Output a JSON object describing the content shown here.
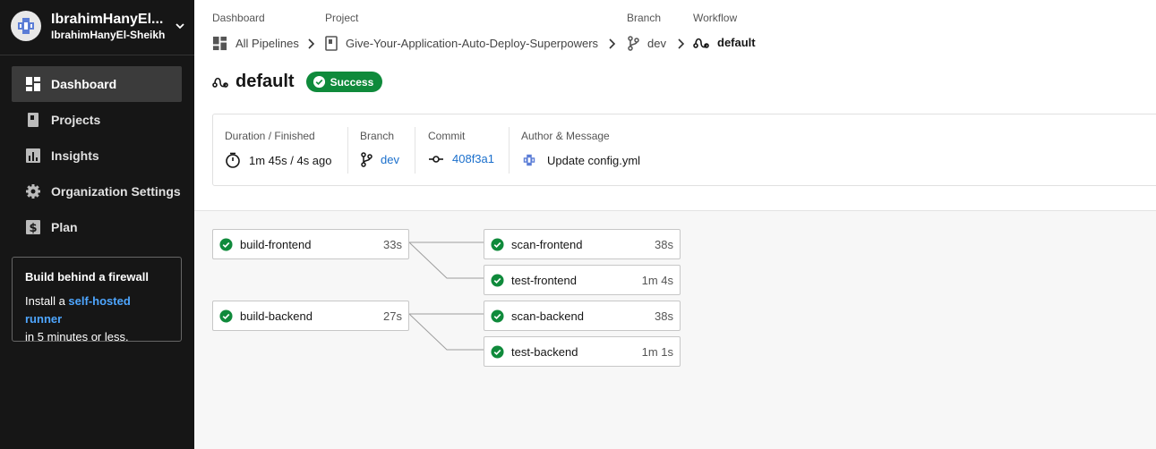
{
  "org": {
    "name": "IbrahimHanyEl...",
    "subtitle": "IbrahimHanyEl-Sheikh"
  },
  "nav": [
    {
      "label": "Dashboard",
      "icon": "dashboard-icon",
      "active": true
    },
    {
      "label": "Projects",
      "icon": "projects-icon",
      "active": false
    },
    {
      "label": "Insights",
      "icon": "insights-icon",
      "active": false
    },
    {
      "label": "Organization Settings",
      "icon": "gear-icon",
      "active": false
    },
    {
      "label": "Plan",
      "icon": "dollar-icon",
      "active": false
    }
  ],
  "promo": {
    "title": "Build behind a firewall",
    "text_before": "Install a ",
    "link": "self-hosted runner",
    "text_after": "in 5 minutes or less."
  },
  "breadcrumbs": [
    {
      "label": "Dashboard",
      "value": "All Pipelines",
      "icon": "pipelines-icon"
    },
    {
      "label": "Project",
      "value": "Give-Your-Application-Auto-Deploy-Superpowers",
      "icon": "project-icon"
    },
    {
      "label": "Branch",
      "value": "dev",
      "icon": "branch-icon"
    },
    {
      "label": "Workflow",
      "value": "default",
      "icon": "workflow-icon"
    }
  ],
  "workflow": {
    "title": "default",
    "status": "Success"
  },
  "info": {
    "duration_label": "Duration / Finished",
    "duration_value": "1m 45s / 4s ago",
    "branch_label": "Branch",
    "branch_value": "dev",
    "commit_label": "Commit",
    "commit_value": "408f3a1",
    "author_label": "Author & Message",
    "author_message": "Update config.yml"
  },
  "jobs": [
    {
      "name": "build-frontend",
      "duration": "33s",
      "status": "success"
    },
    {
      "name": "scan-frontend",
      "duration": "38s",
      "status": "success"
    },
    {
      "name": "test-frontend",
      "duration": "1m 4s",
      "status": "success"
    },
    {
      "name": "build-backend",
      "duration": "27s",
      "status": "success"
    },
    {
      "name": "scan-backend",
      "duration": "38s",
      "status": "success"
    },
    {
      "name": "test-backend",
      "duration": "1m 1s",
      "status": "success"
    }
  ],
  "colors": {
    "sidebar_bg": "#161616",
    "success_green": "#0f8a3b",
    "link_blue": "#1a6fcc",
    "promo_link": "#4ea6ff"
  }
}
